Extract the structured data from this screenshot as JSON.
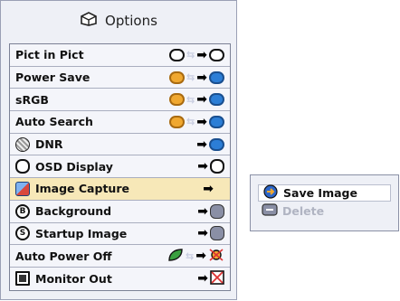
{
  "menu": {
    "title": "Options",
    "items": [
      {
        "label": "Pict in Pict",
        "control": "toggle",
        "value": "off"
      },
      {
        "label": "Power Save",
        "control": "toggle",
        "value": "on"
      },
      {
        "label": "sRGB",
        "control": "toggle",
        "value": "on"
      },
      {
        "label": "Auto Search",
        "control": "toggle",
        "value": "on"
      },
      {
        "label": "DNR",
        "control": "arrow"
      },
      {
        "label": "OSD Display",
        "control": "arrow"
      },
      {
        "label": "Image Capture",
        "control": "arrow",
        "selected": true
      },
      {
        "label": "Background",
        "control": "arrow"
      },
      {
        "label": "Startup Image",
        "control": "arrow"
      },
      {
        "label": "Auto Power Off",
        "control": "toggle"
      },
      {
        "label": "Monitor Out",
        "control": "arrow"
      }
    ]
  },
  "submenu": {
    "items": [
      {
        "label": "Save Image",
        "enabled": true
      },
      {
        "label": "Delete",
        "enabled": false
      }
    ]
  },
  "colors": {
    "accent": "#f7e8b8",
    "panel": "#eef0f6",
    "border": "#7b8195"
  }
}
